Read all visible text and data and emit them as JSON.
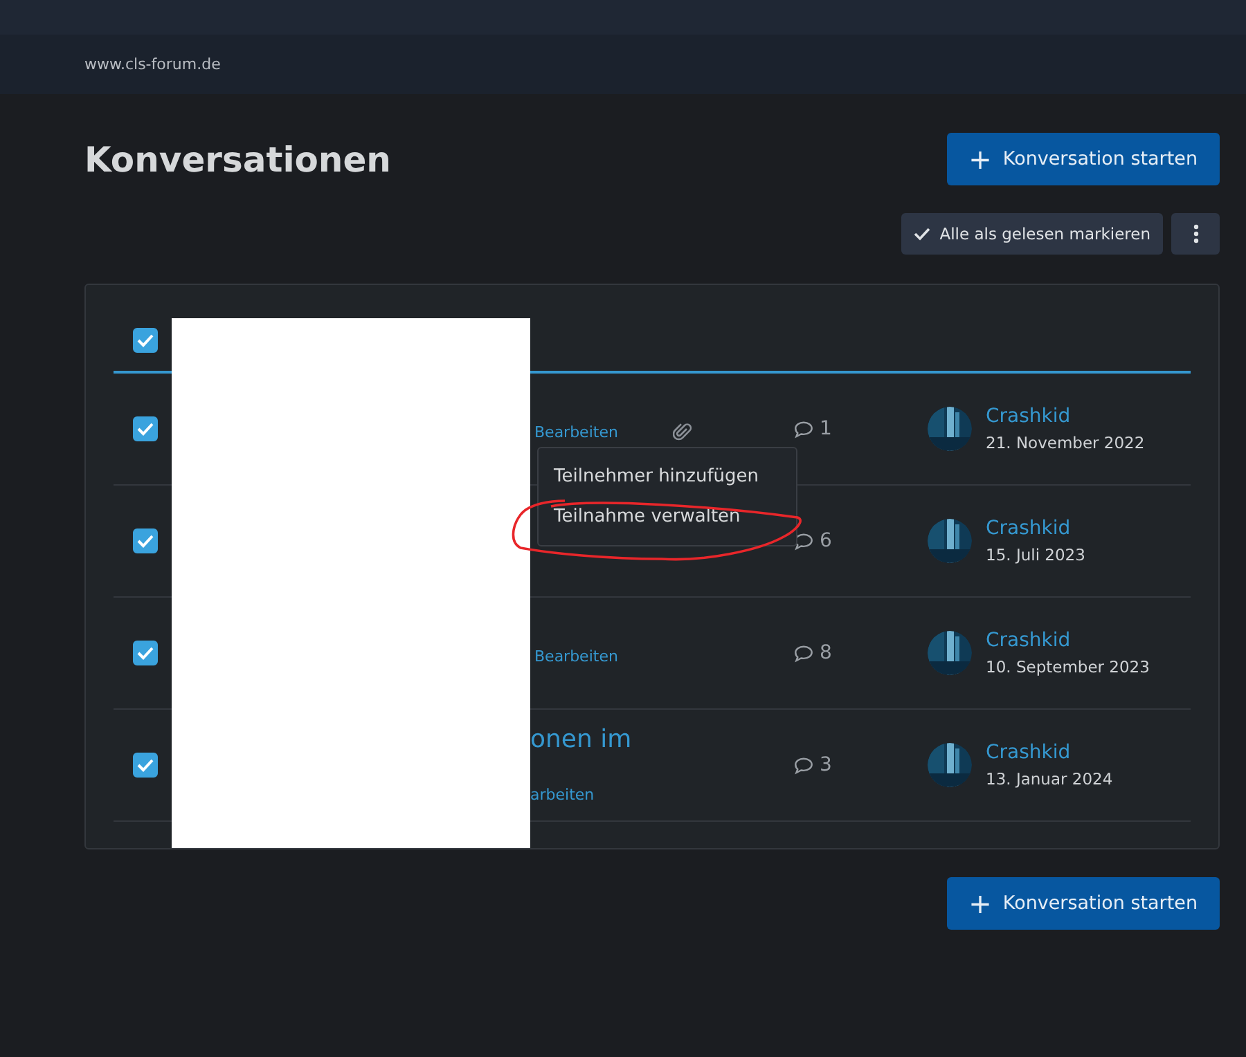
{
  "site": {
    "url": "www.cls-forum.de"
  },
  "page": {
    "title": "Konversationen",
    "start_button": {
      "icon": "+",
      "label": "Konversation starten"
    },
    "mark_read_button": "Alle als gelesen markieren"
  },
  "list": {
    "header_checked": true,
    "rows": [
      {
        "checked": true,
        "edit_label": "Bearbeiten",
        "has_attachment": true,
        "replies": "1",
        "author": "Crashkid",
        "date": "21. November 2022"
      },
      {
        "checked": true,
        "has_attachment": false,
        "replies": "6",
        "author": "Crashkid",
        "date": "15. Juli 2023"
      },
      {
        "checked": true,
        "edit_label": "Bearbeiten",
        "has_attachment": false,
        "replies": "8",
        "author": "Crashkid",
        "date": "10. September 2023"
      },
      {
        "checked": true,
        "title_fragment": "onen im",
        "edit_label": "arbeiten",
        "has_attachment": false,
        "replies": "3",
        "author": "Crashkid",
        "date": "13. Januar 2024"
      }
    ]
  },
  "menu": {
    "items": [
      "Teilnehmer hinzufügen",
      "Teilnahme verwalten"
    ]
  },
  "bottom_button": {
    "icon": "+",
    "label": "Konversation starten"
  }
}
